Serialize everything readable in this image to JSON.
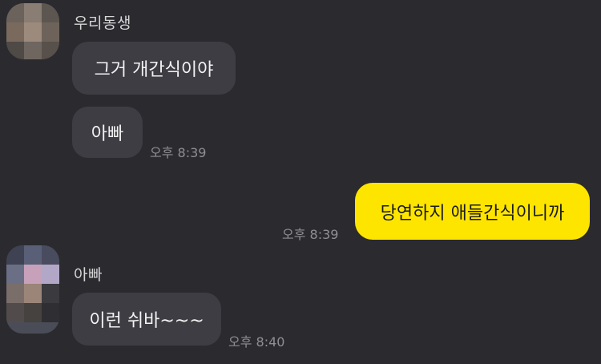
{
  "messages": [
    {
      "sender": "우리동생",
      "text": "그거 개간식이야"
    },
    {
      "text": "아빠",
      "time": "오후 8:39"
    },
    {
      "text": "당연하지 애들간식이니까",
      "time": "오후 8:39",
      "mine": true
    },
    {
      "sender": "아빠",
      "text": "이런 쉬바~~~",
      "time": "오후 8:40"
    }
  ],
  "colors": {
    "background": "#2b2a2f",
    "incoming_bubble": "#3e3d43",
    "outgoing_bubble": "#fee500",
    "timestamp": "#8f8f93"
  }
}
